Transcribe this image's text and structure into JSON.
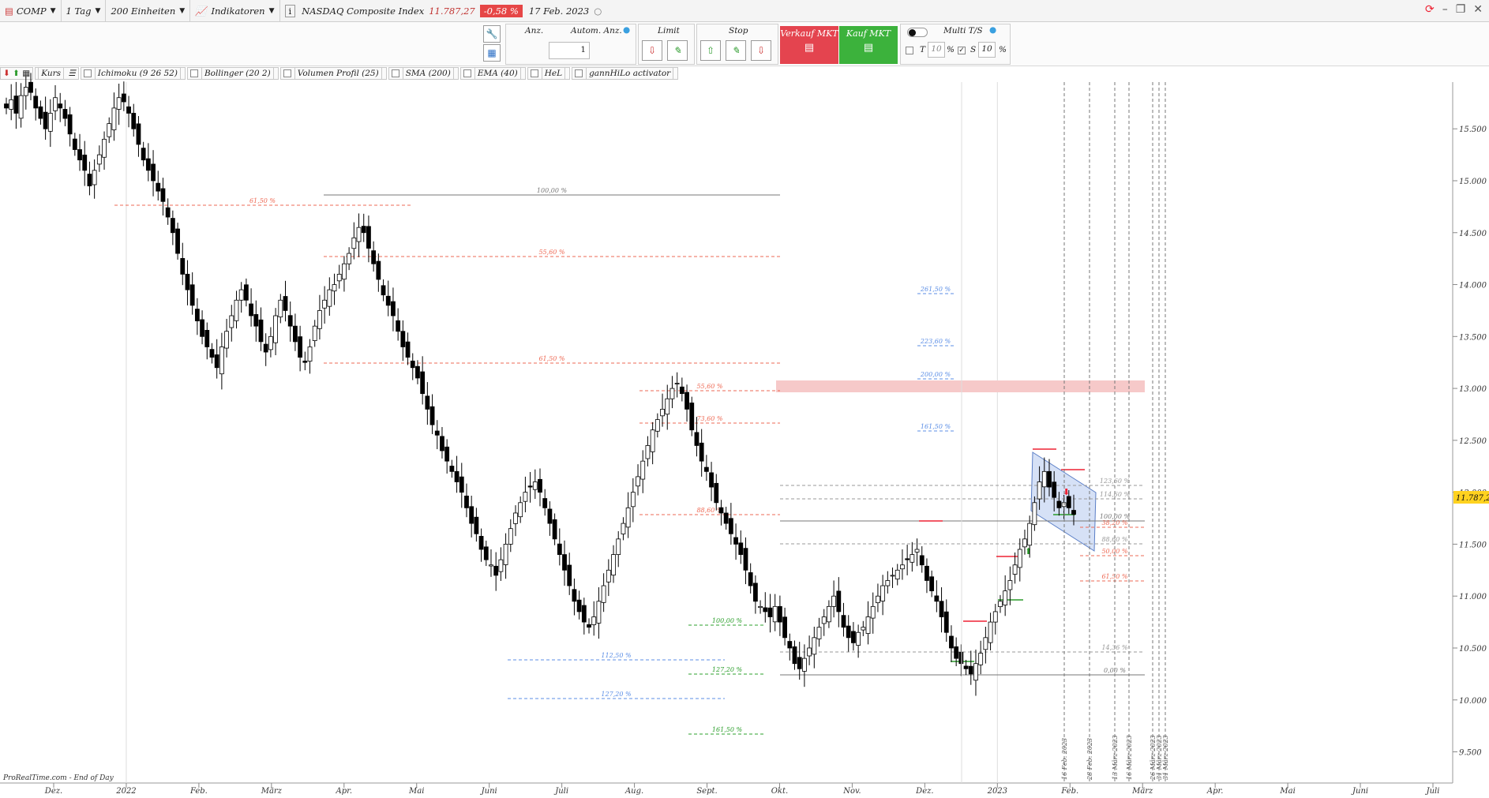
{
  "toolbar": {
    "symbol": "COMP",
    "period": "1 Tag",
    "units": "200 Einheiten",
    "indicators": "Indikatoren",
    "instrument": "NASDAQ Composite Index",
    "last_price": "11.787,27",
    "change": "-0,58 %",
    "date": "17 Feb. 2023"
  },
  "order_panel": {
    "qty_label": "Anz.",
    "auto_qty_label": "Autom. Anz.",
    "qty_value": "1",
    "limit_label": "Limit",
    "stop_label": "Stop",
    "sell_label": "Verkauf MKT",
    "buy_label": "Kauf MKT",
    "multi_label": "Multi T/S",
    "t_label": "T",
    "t_value": "10",
    "s_label": "S",
    "s_value": "10",
    "t_unit": "%",
    "s_unit": "%"
  },
  "indicator_bar": [
    "Kurs",
    "Ichimoku (9 26 52)",
    "Bollinger (20 2)",
    "Volumen Profil (25)",
    "SMA (200)",
    "EMA (40)",
    "HeL",
    "gannHiLo activator"
  ],
  "footer_source": "ProRealTime.com - End of Day",
  "colors": {
    "up": "#ffffff",
    "down": "#000000",
    "fib_red": "#ee6a55",
    "fib_blue": "#5b8ee6",
    "fib_green": "#2ea02e",
    "zone": "#f6c9c9",
    "channel": "#d6e1f6",
    "price_tag": "#ffd21f"
  },
  "chart_data": {
    "type": "candlestick",
    "ylim": [
      9200,
      15950
    ],
    "yticks": [
      9500,
      10000,
      10500,
      11000,
      11500,
      12000,
      12500,
      13000,
      13500,
      14000,
      14500,
      15000,
      15500
    ],
    "ytick_labels": [
      "9.500",
      "10.000",
      "10.500",
      "11.000",
      "11.500",
      "12.000",
      "12.500",
      "13.000",
      "13.500",
      "14.000",
      "14.500",
      "15.000",
      "15.500"
    ],
    "x_month_labels": [
      "Dez.",
      "2022",
      "Feb.",
      "März",
      "Apr.",
      "Mai",
      "Juni",
      "Juli",
      "Aug.",
      "Sept.",
      "Okt.",
      "Nov.",
      "Dez.",
      "2023",
      "Feb.",
      "März",
      "Apr.",
      "Mai",
      "Juni",
      "Juli"
    ],
    "last_value": "11.787,27",
    "closes": [
      15700,
      15780,
      15650,
      15820,
      15900,
      15850,
      15700,
      15600,
      15500,
      15650,
      15800,
      15700,
      15600,
      15450,
      15300,
      15200,
      15100,
      14950,
      15100,
      15250,
      15400,
      15550,
      15700,
      15800,
      15760,
      15650,
      15500,
      15350,
      15200,
      15100,
      15000,
      14900,
      14800,
      14650,
      14500,
      14300,
      14100,
      13950,
      13800,
      13650,
      13500,
      13400,
      13300,
      13200,
      13400,
      13550,
      13700,
      13850,
      13950,
      13850,
      13700,
      13600,
      13450,
      13350,
      13500,
      13700,
      13850,
      13750,
      13600,
      13450,
      13300,
      13250,
      13400,
      13600,
      13750,
      13850,
      13950,
      14000,
      14100,
      14200,
      14300,
      14450,
      14550,
      14500,
      14350,
      14200,
      14050,
      13900,
      13800,
      13700,
      13550,
      13400,
      13300,
      13200,
      13100,
      12950,
      12800,
      12650,
      12550,
      12400,
      12300,
      12200,
      12100,
      12000,
      11850,
      11700,
      11600,
      11450,
      11350,
      11300,
      11200,
      11350,
      11500,
      11650,
      11800,
      11900,
      12000,
      12050,
      12100,
      12000,
      11850,
      11700,
      11550,
      11400,
      11250,
      11100,
      10950,
      10850,
      10750,
      10700,
      10800,
      10950,
      11100,
      11250,
      11400,
      11550,
      11700,
      11850,
      12000,
      12150,
      12300,
      12450,
      12600,
      12700,
      12800,
      12900,
      13000,
      13050,
      12950,
      12800,
      12600,
      12450,
      12300,
      12200,
      12050,
      11900,
      11800,
      11700,
      11600,
      11500,
      11400,
      11250,
      11100,
      10950,
      10900,
      10850,
      10800,
      10900,
      10750,
      10600,
      10500,
      10350,
      10300,
      10400,
      10500,
      10600,
      10700,
      10800,
      10900,
      11000,
      10850,
      10700,
      10600,
      10550,
      10650,
      10700,
      10800,
      10900,
      11000,
      11100,
      11150,
      11200,
      11250,
      11300,
      11350,
      11400,
      11450,
      11300,
      11150,
      11050,
      10950,
      10800,
      10650,
      10500,
      10400,
      10350,
      10300,
      10250,
      10350,
      10450,
      10600,
      10750,
      10850,
      10950,
      11050,
      11150,
      11300,
      11450,
      11550,
      11700,
      11900,
      12100,
      12200,
      12050,
      11950,
      11850,
      11900,
      11850,
      11787
    ]
  },
  "fib_labels": {
    "a_615": "61,50 %",
    "a_100": "100,00 %",
    "a_556": "55,60 %",
    "b_615": "61,50 %",
    "b_556": "55,60 %",
    "b_736": "73,60 %",
    "b_886": "88,60 %",
    "c_2615": "261,50 %",
    "c_2236": "223,60 %",
    "c_2000": "200,00 %",
    "c_1615": "161,50 %",
    "d_1000": "100,00 %",
    "d_1272": "127,20 %",
    "d_1615": "161,50 %",
    "e_1125": "112,50 %",
    "e_1272": "127,20 %",
    "r_1236": "123,60 %",
    "r_1146": "114,60 %",
    "r_1000": "100,00 %",
    "r_886": "88,60 %",
    "r_382": "38,20 %",
    "r_500": "50,00 %",
    "r_615": "61,50 %",
    "r_1436": "14,36 %",
    "r_000": "0,00 %"
  },
  "date_markers": [
    "16 Feb. 2023",
    "28 Feb. 2023",
    "13 März 2023",
    "16 März 2023",
    "26 März 2023",
    "31 März 2023",
    "31 März 2023"
  ]
}
